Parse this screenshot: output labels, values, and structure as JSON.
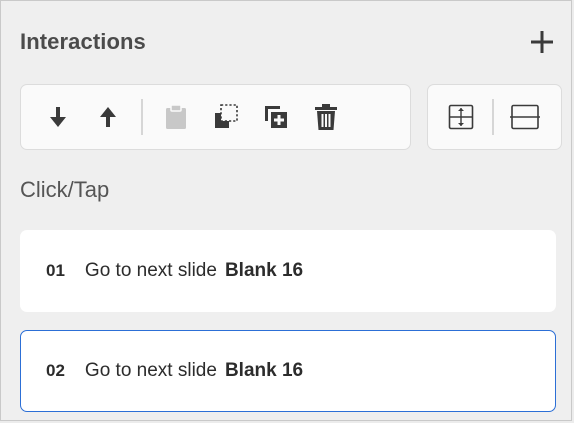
{
  "panel": {
    "title": "Interactions",
    "section_label": "Click/Tap"
  },
  "toolbar": {
    "group1": [
      {
        "name": "move-down-icon",
        "state": "enabled"
      },
      {
        "name": "move-up-icon",
        "state": "enabled"
      },
      {
        "name": "paste-icon",
        "state": "disabled"
      },
      {
        "name": "copy-icon",
        "state": "enabled"
      },
      {
        "name": "duplicate-icon",
        "state": "enabled"
      },
      {
        "name": "delete-icon",
        "state": "enabled"
      }
    ],
    "group2": [
      {
        "name": "expand-icon",
        "state": "enabled"
      },
      {
        "name": "collapse-icon",
        "state": "enabled"
      }
    ]
  },
  "interactions": [
    {
      "number": "01",
      "action": "Go to next slide",
      "target": "Blank 16",
      "selected": false
    },
    {
      "number": "02",
      "action": "Go to next slide",
      "target": "Blank 16",
      "selected": true
    }
  ],
  "colors": {
    "panel_bg": "#efefef",
    "icon": "#3a3a3a",
    "icon_disabled": "#c8c8c8",
    "selection_border": "#2c6fd6"
  }
}
